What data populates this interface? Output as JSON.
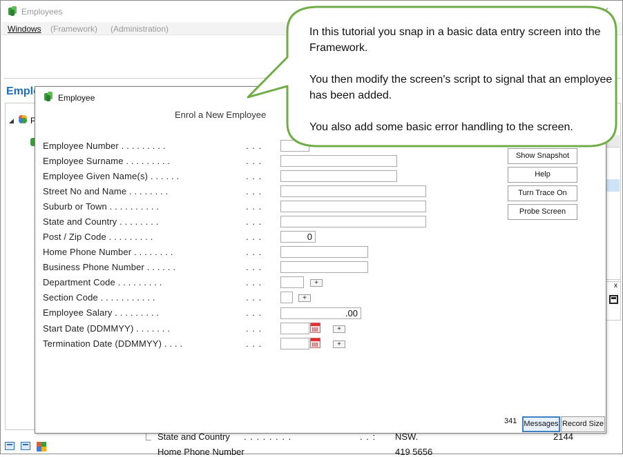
{
  "outer_window": {
    "title": "Employees",
    "close_glyph": "✕",
    "menu": [
      "Windows",
      "(Framework)",
      "(Administration)"
    ]
  },
  "background": {
    "heading": "Emplo",
    "tree_letter": "P",
    "rows": [
      {
        "label": "State and Country",
        "dots": ". . . . . . . .",
        "sep": ". . :",
        "value": "NSW.",
        "extra": "2144"
      },
      {
        "label": "Home Phone Number",
        "dots": "",
        "sep": "",
        "value": "419 5656",
        "extra": ""
      }
    ],
    "right_close": "x"
  },
  "dialog": {
    "title": "Employee",
    "heading": "Enrol a New Employee",
    "fields": [
      {
        "label": "Employee Number . . . . . . . . .",
        "dots": ". . .",
        "value": ""
      },
      {
        "label": "Employee Surname . . . . . . . . .",
        "dots": ". . .",
        "value": ""
      },
      {
        "label": "Employee Given Name(s) . . . . . .",
        "dots": ". . .",
        "value": ""
      },
      {
        "label": "Street No and Name . . . . . . . .",
        "dots": ". . .",
        "value": ""
      },
      {
        "label": "Suburb or Town . . . . . . . . . .",
        "dots": ". . .",
        "value": ""
      },
      {
        "label": "State and Country . . . . . . . .",
        "dots": ". . .",
        "value": ""
      },
      {
        "label": "Post / Zip Code . . . . . . . . .",
        "dots": ". . .",
        "value": "0"
      },
      {
        "label": "Home Phone Number . . . . . . . .",
        "dots": ". . .",
        "value": ""
      },
      {
        "label": "Business Phone Number . . . . . .",
        "dots": ". . .",
        "value": ""
      },
      {
        "label": "Department Code . . . . . . . . .",
        "dots": ". . .",
        "value": "",
        "plus": "+"
      },
      {
        "label": "Section Code . . . . . . . . . . .",
        "dots": ". . .",
        "value": "",
        "plus": "+"
      },
      {
        "label": "Employee Salary . . . . . . . . .",
        "dots": ". . .",
        "value": ".00"
      },
      {
        "label": "Start Date (DDMMYY) . . . . . . .",
        "dots": ". . .",
        "value": "",
        "plus": "+"
      },
      {
        "label": "Termination Date (DDMMYY) . . . .",
        "dots": ". . .",
        "value": "",
        "plus": "+"
      }
    ],
    "side_buttons": [
      "Show Snapshot",
      "Help",
      "Turn Trace On",
      "Probe Screen"
    ],
    "counter_text": "341",
    "bottom_buttons": [
      "Messages",
      "Record Size"
    ]
  },
  "callout": {
    "paragraphs": [
      "In this tutorial  you snap in a basic data entry screen into the Framework.",
      "You then modify the screen's script to signal that an employee has been added.",
      "You also add some basic error handling to the screen."
    ]
  },
  "colors": {
    "callout_border": "#70ad47",
    "heading_blue": "#1c6fb5",
    "icon_green": "#3e9c3e"
  },
  "icons": [
    "framework-app-icon",
    "close-icon",
    "calendar-icon",
    "expand-icon"
  ]
}
